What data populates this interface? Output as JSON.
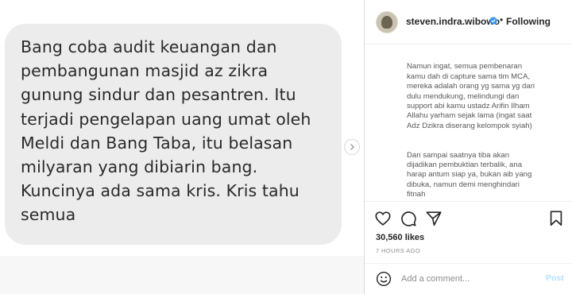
{
  "post": {
    "image_text": "Bang coba audit keuangan dan\npembangunan masjid az zikra\ngunung sindur dan pesantren. Itu\nterjadi pengelapan uang umat oleh\nMeldi dan Bang Taba, itu belasan\nmilyaran yang dibiarin bang.\nKuncinya ada sama kris. Kris tahu\nsemua"
  },
  "header": {
    "username": "steven.indra.wibowo",
    "separator": "•",
    "follow_status": "Following"
  },
  "caption": {
    "paragraph_1": "Namun ingat, semua pembenaran\nkamu dah di capture sama tim MCA,\nmereka adalah orang yg sama yg dari\ndulu mendukung, melindungi dan\nsupport abi kamu ustadz Arifin Ilham\nAllahu yarham sejak lama (ingat saat\nAdz Dzikra diserang kelompok syiah)",
    "paragraph_2": "Dan sampai saatnya tiba akan\ndijadikan pembuktian terbalik, ana\nharap antum siap ya, bukan aib yang\ndibuka, namun demi menghindari\nfitnah"
  },
  "stats": {
    "likes": "30,560 likes",
    "time": "7 HOURS AGO"
  },
  "comment": {
    "placeholder": "Add a comment...",
    "post_label": "Post"
  },
  "icons": [
    "heart-icon",
    "comment-icon",
    "share-icon",
    "bookmark-icon",
    "emoji-icon",
    "verified-badge-icon",
    "chevron-right-icon"
  ],
  "colors": {
    "bubble": "#ececec",
    "verified": "#3897f0",
    "post_button_disabled": "#b2dffc"
  }
}
